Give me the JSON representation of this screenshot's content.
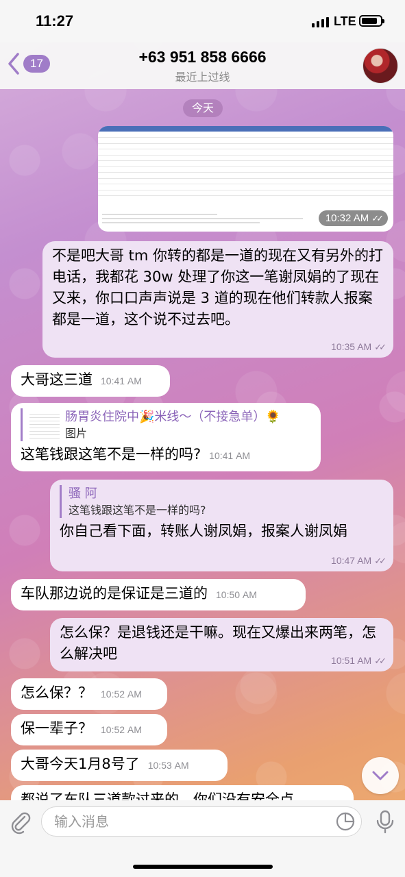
{
  "status": {
    "time": "11:27",
    "network": "LTE"
  },
  "header": {
    "back_badge": "17",
    "title": "+63 951 858 6666",
    "subtitle": "最近上过线"
  },
  "date_pill": "今天",
  "image_message": {
    "time": "10:32 AM"
  },
  "messages": [
    {
      "text": "不是吧大哥 tm 你转的都是一道的现在又有另外的打电话，我都花 30w 处理了你这一笔谢凤娟的了现在又来，你口口声声说是 3 道的现在他们转款人报案都是一道，这个说不过去吧。",
      "time": "10:35 AM"
    },
    {
      "text": "大哥这三道",
      "time": "10:41 AM"
    },
    {
      "reply_name": "肠胃炎住院中🎉米线～（不接急单）🌻",
      "reply_text": "图片",
      "text": "这笔钱跟这笔不是一样的吗?",
      "time": "10:41 AM"
    },
    {
      "reply_name": "骚 阿",
      "reply_text": "这笔钱跟这笔不是一样的吗?",
      "text": "你自己看下面，转账人谢凤娟，报案人谢凤娟",
      "time": "10:47 AM"
    },
    {
      "text": "车队那边说的是保证是三道的",
      "time": "10:50 AM"
    },
    {
      "text": "怎么保？是退钱还是干嘛。现在又爆出来两笔，怎么解决吧",
      "time": "10:51 AM"
    },
    {
      "text": "怎么保？？",
      "time": "10:52 AM"
    },
    {
      "text": "保一辈子？",
      "time": "10:52 AM"
    },
    {
      "text": "大哥今天1月8号了",
      "time": "10:53 AM"
    },
    {
      "text": "都说了车队三道款过来的，你们没有安全点",
      "time": ""
    }
  ],
  "input": {
    "placeholder": "输入消息"
  },
  "icons": {
    "back": "chevron-left-icon",
    "checks": "double-check-icon",
    "scroll": "chevron-down-icon",
    "attach": "paperclip-icon",
    "sticker": "sticker-icon",
    "mic": "microphone-icon"
  },
  "colors": {
    "accent": "#a07cc8",
    "outgoing_bubble": "#efe2f4",
    "incoming_bubble": "#ffffff"
  }
}
